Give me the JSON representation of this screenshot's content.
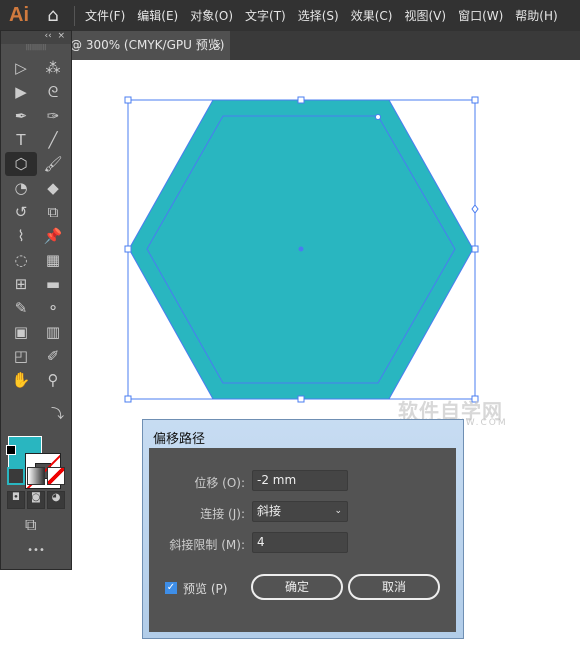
{
  "app": {
    "logo": "Ai",
    "home_icon": "home-icon"
  },
  "menu": [
    "文件(F)",
    "编辑(E)",
    "对象(O)",
    "文字(T)",
    "选择(S)",
    "效果(C)",
    "视图(V)",
    "窗口(W)",
    "帮助(H)"
  ],
  "tab": {
    "title": "@ 300% (CMYK/GPU 预览)",
    "close": "×"
  },
  "toolbar": {
    "collapse": "‹‹",
    "close": "×",
    "grip": "||||||||||",
    "tools": [
      [
        "selection",
        "▷"
      ],
      [
        "magic-wand",
        "⁂"
      ],
      [
        "direct-selection",
        "▶"
      ],
      [
        "lasso",
        "ᘓ"
      ],
      [
        "pen",
        "✒"
      ],
      [
        "curvature",
        "✑"
      ],
      [
        "type",
        "T"
      ],
      [
        "line",
        "╱"
      ],
      [
        "polygon",
        "⬡"
      ],
      [
        "paintbrush",
        "🖌"
      ],
      [
        "shaper",
        "◔"
      ],
      [
        "eraser",
        "◆"
      ],
      [
        "rotate",
        "↺"
      ],
      [
        "scale",
        "⧉"
      ],
      [
        "puppet-warp",
        "⌇"
      ],
      [
        "pin",
        "📌"
      ],
      [
        "shape-builder",
        "◌"
      ],
      [
        "perspective-grid",
        "▦"
      ],
      [
        "mesh",
        "⊞"
      ],
      [
        "gradient",
        "▬"
      ],
      [
        "eyedropper",
        "✎"
      ],
      [
        "blend",
        "⚬"
      ],
      [
        "symbol-sprayer",
        "▣"
      ],
      [
        "column-graph",
        "▥"
      ],
      [
        "artboard",
        "◰"
      ],
      [
        "slice",
        "✐"
      ],
      [
        "hand",
        "✋"
      ],
      [
        "zoom",
        "⚲"
      ]
    ],
    "more": "•••"
  },
  "colors": {
    "fill": "#29b6c0",
    "shape": "#29b6c0",
    "path": "#4a7cf0"
  },
  "dialog": {
    "title": "偏移路径",
    "offset_label": "位移 (O):",
    "offset_value": "-2 mm",
    "joins_label": "连接 (J):",
    "joins_value": "斜接",
    "miter_label": "斜接限制 (M):",
    "miter_value": "4",
    "preview_label": "预览 (P)",
    "preview_checked": true,
    "ok": "确定",
    "cancel": "取消"
  },
  "watermark": {
    "main": "软件自学网",
    "sub": "WWW.RJZXW.COM"
  }
}
